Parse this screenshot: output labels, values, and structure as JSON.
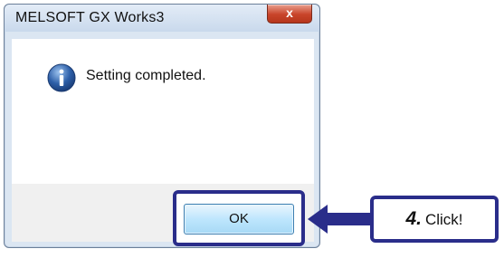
{
  "window": {
    "title": "MELSOFT GX Works3",
    "close_label": "x"
  },
  "dialog": {
    "message": "Setting completed.",
    "icon": "info-icon"
  },
  "buttons": {
    "ok_label": "OK"
  },
  "callout": {
    "step": "4.",
    "action": "Click!"
  },
  "colors": {
    "highlight": "#2a2d8a",
    "button_blue": "#bee6fd",
    "info_icon": "#2d5fa8"
  }
}
